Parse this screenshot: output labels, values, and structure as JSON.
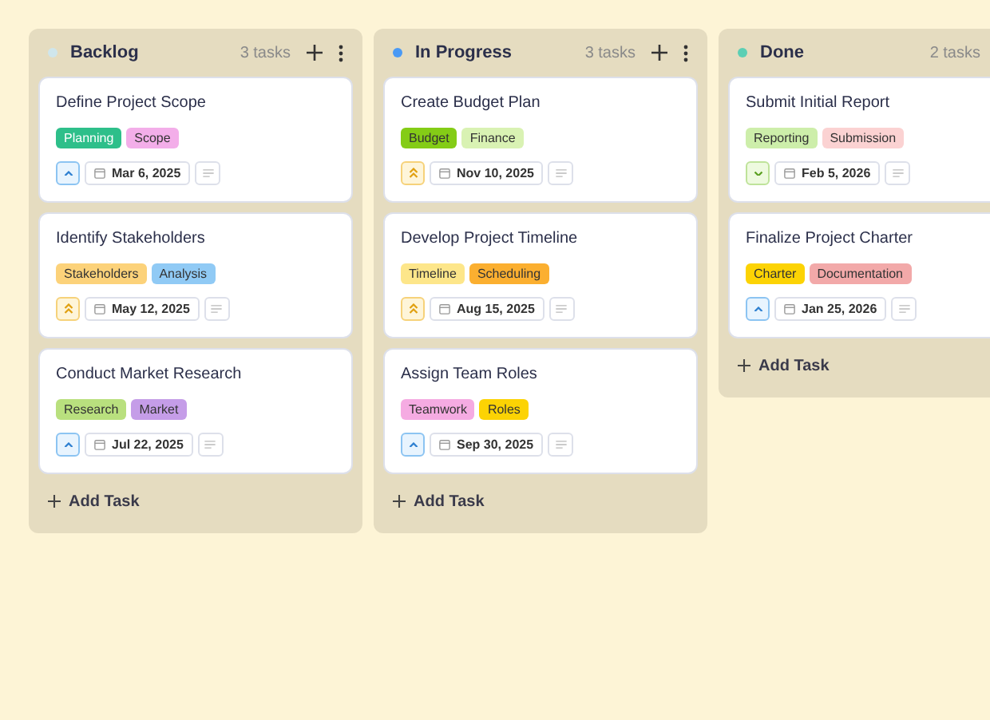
{
  "columns": [
    {
      "title": "Backlog",
      "color": "#cfe6ec",
      "count": "3 tasks",
      "actions": true,
      "cards": [
        {
          "title": "Define Project Scope",
          "tags": [
            {
              "label": "Planning",
              "color": "#2ebf8a"
            },
            {
              "label": "Scope",
              "color": "#f3aee9"
            }
          ],
          "priority": {
            "kind": "low"
          },
          "date": "Mar 6, 2025"
        },
        {
          "title": "Identify Stakeholders",
          "tags": [
            {
              "label": "Stakeholders",
              "color": "#fcd27a"
            },
            {
              "label": "Analysis",
              "color": "#90caf5"
            }
          ],
          "priority": {
            "kind": "high"
          },
          "date": "May 12, 2025"
        },
        {
          "title": "Conduct Market Research",
          "tags": [
            {
              "label": "Research",
              "color": "#b9e07e"
            },
            {
              "label": "Market",
              "color": "#c59de8"
            }
          ],
          "priority": {
            "kind": "low"
          },
          "date": "Jul 22, 2025"
        }
      ]
    },
    {
      "title": "In Progress",
      "color": "#4a9af5",
      "count": "3 tasks",
      "actions": true,
      "cards": [
        {
          "title": "Create Budget Plan",
          "tags": [
            {
              "label": "Budget",
              "color": "#84cc16"
            },
            {
              "label": "Finance",
              "color": "#d9f2b3"
            }
          ],
          "priority": {
            "kind": "high"
          },
          "date": "Nov 10, 2025"
        },
        {
          "title": "Develop Project Timeline",
          "tags": [
            {
              "label": "Timeline",
              "color": "#fde68a"
            },
            {
              "label": "Scheduling",
              "color": "#fbaf30"
            }
          ],
          "priority": {
            "kind": "high"
          },
          "date": "Aug 15, 2025"
        },
        {
          "title": "Assign Team Roles",
          "tags": [
            {
              "label": "Teamwork",
              "color": "#f5abe2"
            },
            {
              "label": "Roles",
              "color": "#fcd304"
            }
          ],
          "priority": {
            "kind": "low"
          },
          "date": "Sep 30, 2025"
        }
      ]
    },
    {
      "title": "Done",
      "color": "#5ccfb4",
      "count": "2 tasks",
      "actions": false,
      "cards": [
        {
          "title": "Submit Initial Report",
          "tags": [
            {
              "label": "Reporting",
              "color": "#cdeeaa"
            },
            {
              "label": "Submission",
              "color": "#fbd2d2"
            }
          ],
          "priority": {
            "kind": "lowest"
          },
          "date": "Feb 5, 2026"
        },
        {
          "title": "Finalize Project Charter",
          "tags": [
            {
              "label": "Charter",
              "color": "#fcd304"
            },
            {
              "label": "Documentation",
              "color": "#f2a9a9"
            }
          ],
          "priority": {
            "kind": "low"
          },
          "date": "Jan 25, 2026"
        }
      ]
    }
  ],
  "add_label": [
    "Add Task",
    "Add Task",
    "Add Task"
  ]
}
